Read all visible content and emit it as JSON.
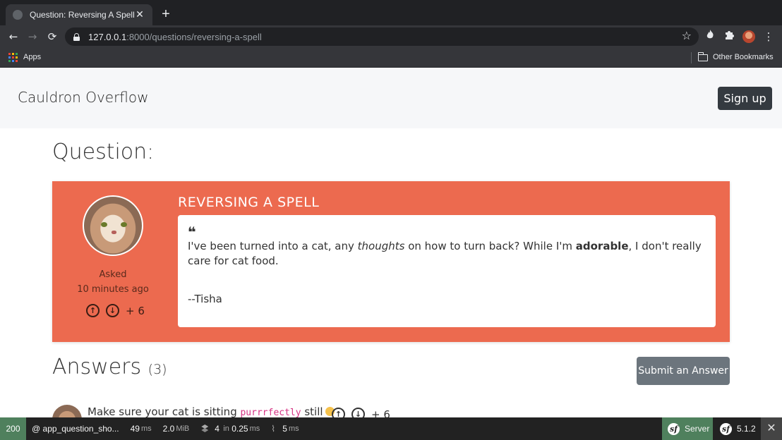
{
  "browser": {
    "tab_title": "Question: Reversing A Spell",
    "tab_close": "✕",
    "new_tab": "+",
    "url_host": "127.0.0.1",
    "url_rest": ":8000/questions/reversing-a-spell",
    "back": "←",
    "forward": "→",
    "reload": "⟳",
    "star": "☆",
    "menu": "⋮",
    "bookmarks": {
      "apps_label": "Apps",
      "other_label": "Other Bookmarks"
    }
  },
  "site": {
    "brand": "Cauldron Overflow",
    "signup_label": "Sign up"
  },
  "page": {
    "heading": "Question:"
  },
  "question": {
    "title": "REVERSING A SPELL",
    "asked_label": "Asked",
    "asked_time": "10 minutes ago",
    "vote_up": "↑",
    "vote_down": "↓",
    "vote_count": "+ 6",
    "quote_mark": "❝",
    "body_part1": "I've been turned into a cat, any ",
    "body_em": "thoughts",
    "body_part2": " on how to turn back? While I'm ",
    "body_strong": "adorable",
    "body_part3": ", I don't really care for cat food.",
    "author": "--Tisha"
  },
  "answers": {
    "heading": "Answers",
    "count": "(3)",
    "submit_label": "Submit an Answer",
    "first": {
      "text_before": "Make sure your cat is sitting ",
      "code": "purrrfectly",
      "text_after": " still",
      "vote_count": "+ 6"
    }
  },
  "debug_toolbar": {
    "status": "200",
    "route": "@ app_question_sho...",
    "time_value": "49",
    "time_unit": "ms",
    "memory_value": "2.0",
    "memory_unit": "MiB",
    "db_count": "4",
    "db_in": "in",
    "db_time": "0.25",
    "db_unit": "ms",
    "twig_value": "5",
    "twig_unit": "ms",
    "server_label": "Server",
    "version": "5.1.2",
    "close": "✕"
  },
  "colors": {
    "question_card": "#ec6a4f",
    "header_bg": "#f6f7f9",
    "signup_bg": "#343a40",
    "submit_bg": "#6c757d",
    "status_ok": "#4f805d"
  }
}
